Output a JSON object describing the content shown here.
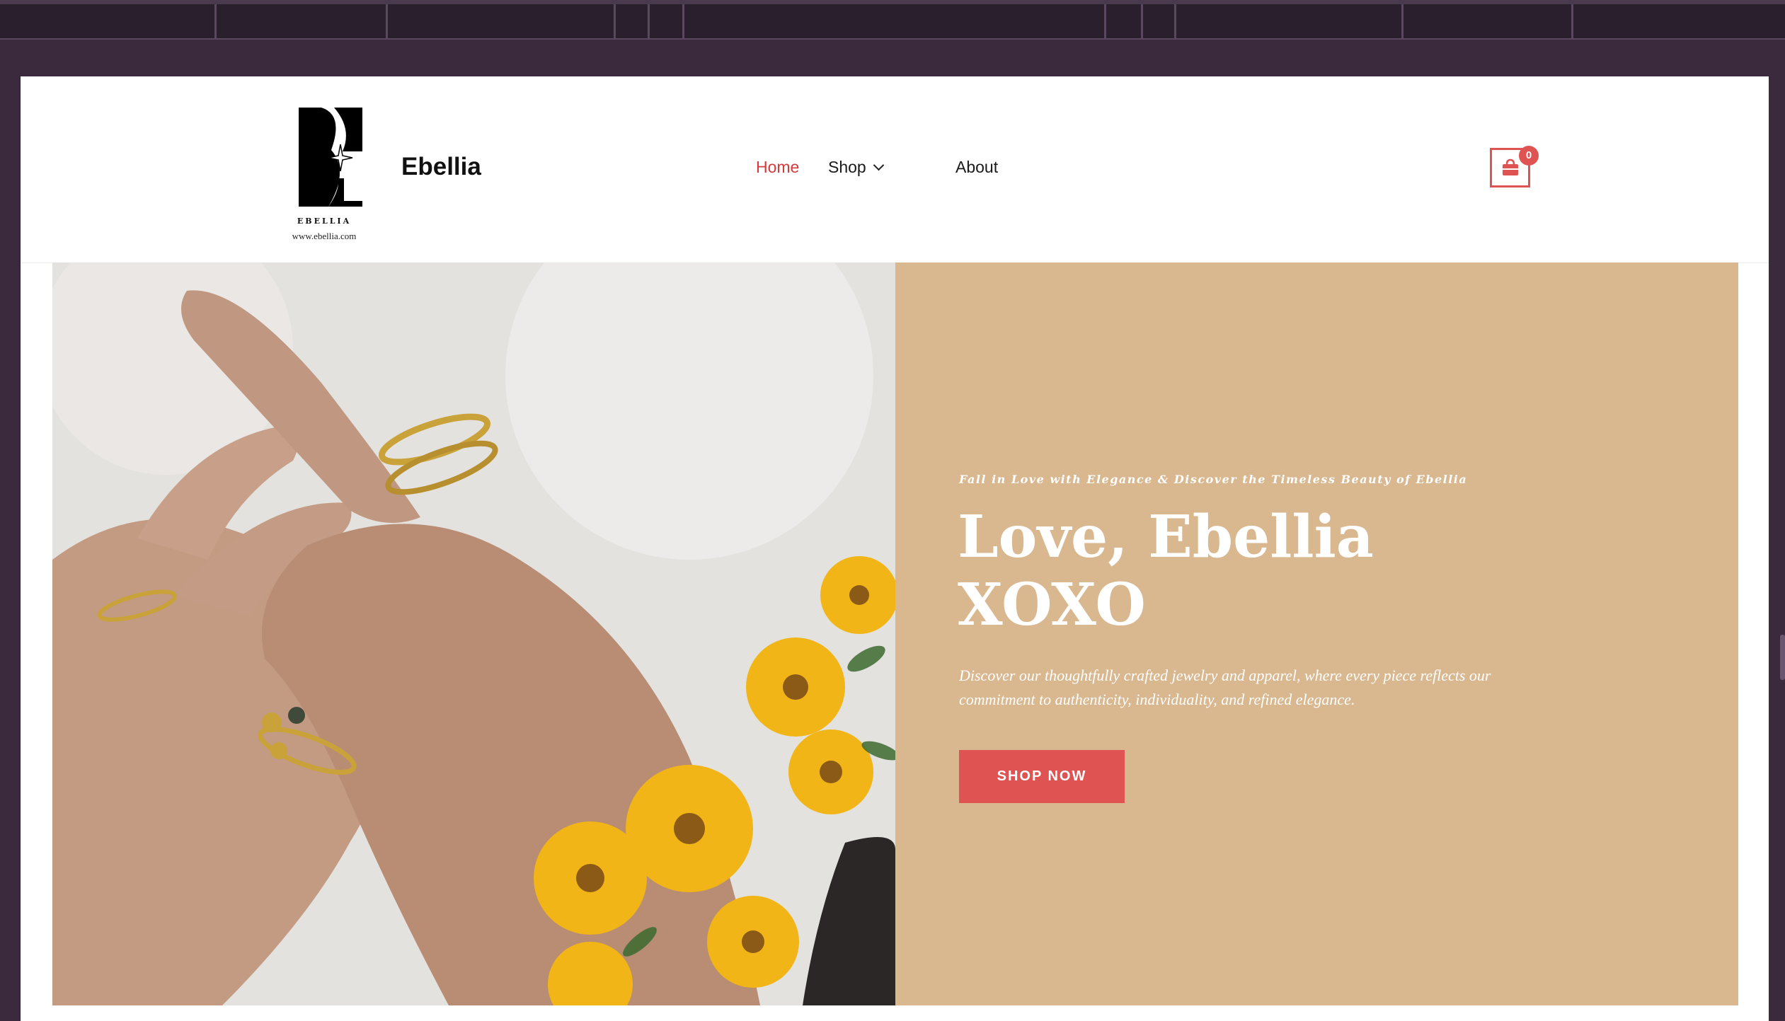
{
  "site": {
    "title": "Ebellia",
    "logo_word": "EBELLIA",
    "logo_url": "www.ebellia.com"
  },
  "nav": {
    "items": [
      {
        "label": "Home",
        "active": true
      },
      {
        "label": "Shop",
        "has_dropdown": true
      },
      {
        "label": "About"
      }
    ]
  },
  "cart": {
    "count": "0",
    "icon": "shopping-bag-icon"
  },
  "hero": {
    "eyebrow": "Fall in Love with Elegance & Discover the Timeless Beauty of Ebellia",
    "headline_line1": "Love, Ebellia",
    "headline_line2": "XOXO",
    "description": "Discover our thoughtfully crafted jewelry and apparel, where every piece reflects our commitment to authenticity, individuality, and refined elegance.",
    "cta_label": "SHOP NOW",
    "image_subject": "hands-with-gold-rings-and-yellow-flowers"
  },
  "colors": {
    "accent": "#e05353",
    "panel": "#d9b78f",
    "chrome": "#3b2a3e"
  }
}
